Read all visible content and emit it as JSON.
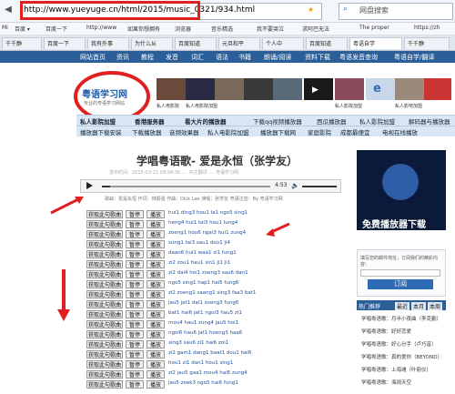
{
  "browser": {
    "url": "http://www.yueyuge.cn/html/2015/music_0321/934.html",
    "search_placeholder": "网盘搜索",
    "bookmarks": [
      "Mi",
      "百度 ▾",
      "百度一下",
      "http://www",
      "如果你想拥有",
      "浏览器",
      "音乐精选",
      "我不要哭泣",
      "求阿巴无法",
      "The proper",
      "https://zh"
    ],
    "tabs": [
      "千千静",
      "百度一下",
      "我有外事",
      "为什么从",
      "百度知道",
      "元旦和平",
      "个人中",
      "百度知道",
      "粤语自学",
      "千千静"
    ]
  },
  "site": {
    "nav": [
      "网站首页",
      "资讯",
      "教程",
      "发音",
      "词汇",
      "语法",
      "书籍",
      "朗诵/阅读",
      "资料下载",
      "粤语发音查询",
      "粤语自学/翻译"
    ],
    "logo_title": "粤语学习网",
    "logo_subtitle": "专业的粤语学习网站",
    "thumbs": [
      "私人电影院",
      "私人电影院加盟",
      "",
      "",
      "私人影院加盟",
      "私人影吧加盟",
      "",
      "",
      "",
      ""
    ],
    "link_row1": [
      "私人影院加盟",
      "香港服务器",
      "看大片的播放器",
      "下载qq视频播放器",
      "西瓜播放器",
      "私人影院加盟",
      "解码器与播放器"
    ],
    "link_row2": [
      "播放器下载安装",
      "下载播放器",
      "音频效果器",
      "私人电影院加盟",
      "播放器下载网",
      "家庭影院",
      "成都最便宜",
      "电视在线播放"
    ]
  },
  "song": {
    "title": "学唱粤语歌- 爱是永恒（张学友）",
    "meta": "发布时间：2015-03-21 09:04:36  ....  中文翻译  ....  粤语学习网",
    "time": "4:53",
    "progress": 0.05,
    "info": "歌曲：爱是永恒  作词：林振强  作曲：Dick Lee  演唱：张学友  粤语注音：By 粤语学习网"
  },
  "rows": {
    "get_label": "获取此句歌曲",
    "pause_label": "暂停",
    "play_label": "播放",
    "lyrics": [
      "hui1 ding3 hou1 la1 ngo5 sing1",
      "heng4 hui1 tai3 hou1 lung4",
      "zoeng1 hou6 ngai3 hui1 zung4",
      "sung1 tai3 sau1 dou1 ji4",
      "daan6 hui1 waa1 zi1 fung1",
      "zi2 zou1 hau1 sin1 ji1 ji1",
      "zi2 dai4 hoi1 zoeng3 sau6 dan1",
      "ngo5 sing1 hap1 hai5 fung6",
      "zi2 zoeng1 saang1 sing3 faa3 bat1",
      "jau5 jat1 dai1 zoeng3 fung6",
      "bat1 hai6 jat1 ngoi3 hau5 zi1",
      "mou4 hau1 zung4 jau5 hoi1",
      "ngoi6 hau6 jat1 hoeng3 haa6",
      "sing3 sau6 zi1 hai6 zoi1",
      "zi2 gam1 dang1 baat1 dou1 hai6",
      "hou1 zi1 dan1 hou1 sing1",
      "zi2 jau5 gaa1 mou4 hai6 zung4",
      "jau5 zoek3 ngo5 hai6 fung1"
    ]
  },
  "right": {
    "ad_text": "免费播放器下载",
    "promo_text": "填写您的邮件地址，订阅我们的精彩内容：",
    "promo_button": "订阅",
    "hot_title": "热门推荐",
    "hot_tabs": [
      "最近",
      "本月",
      "本周"
    ],
    "items": [
      "学唱粤语歌：月半小夜曲（李克勤）",
      "学唱粤语歌：好好恋爱",
      "学唱粤语歌：好心分手（卢巧音）",
      "学唱粤语歌：真的爱你（BEYOND）",
      "学唱粤语歌：上海滩（叶丽仪）",
      "学唱粤语歌：海阔天空"
    ]
  },
  "colors": {
    "accent": "#2b5f9a",
    "annotation": "#e02020"
  }
}
